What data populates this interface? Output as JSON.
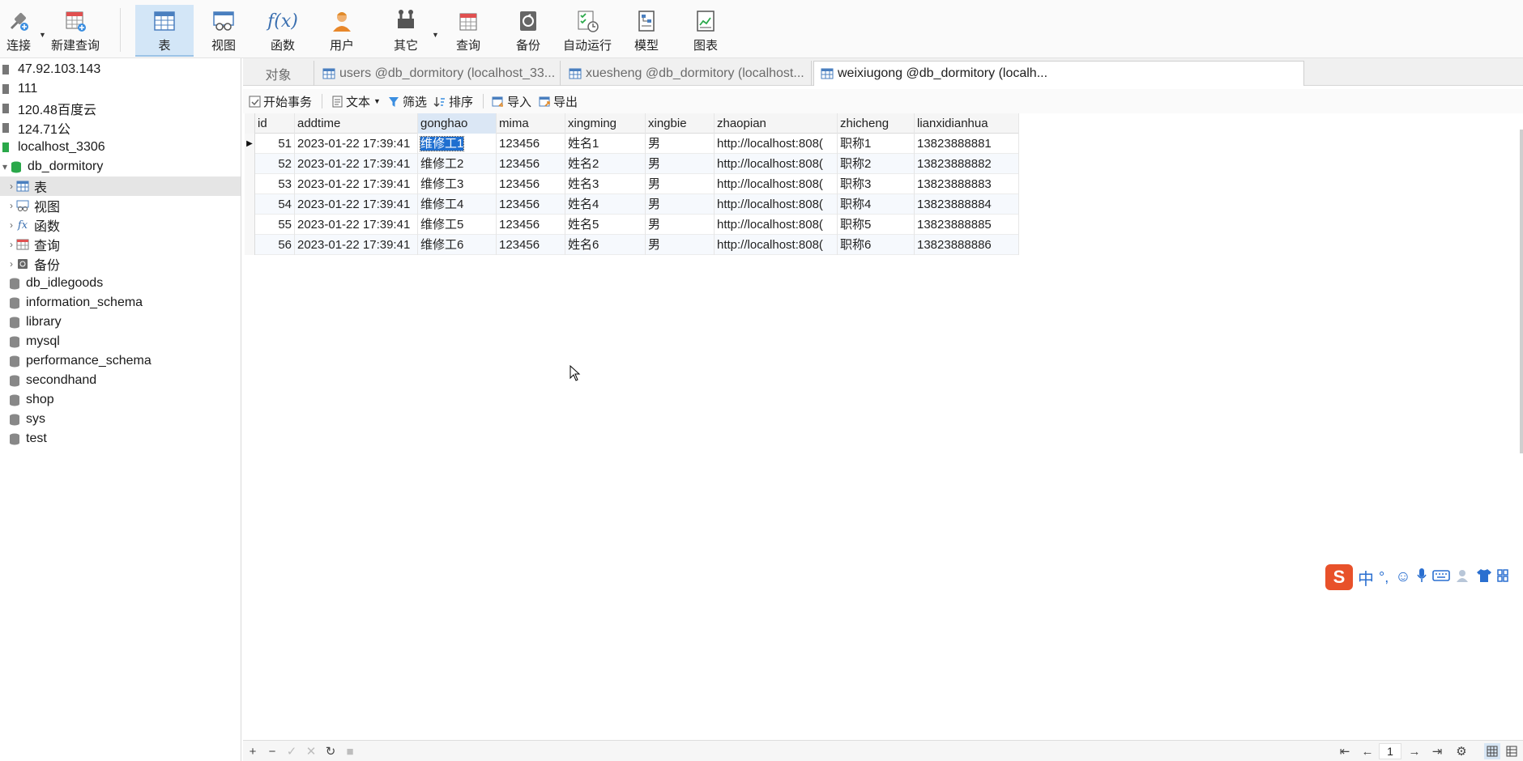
{
  "toolbar": {
    "connect": "连接",
    "new_query": "新建查询",
    "table": "表",
    "view": "视图",
    "function": "函数",
    "user": "用户",
    "other": "其它",
    "query": "查询",
    "backup": "备份",
    "auto_run": "自动运行",
    "model": "模型",
    "chart": "图表"
  },
  "sidebar": {
    "connections": [
      {
        "label": "47.92.103.143"
      },
      {
        "label": "111"
      },
      {
        "label": "120.48百度云"
      },
      {
        "label": "124.71公"
      },
      {
        "label": "localhost_3306"
      }
    ],
    "db_open": "db_dormitory",
    "db_children": [
      {
        "label": "表"
      },
      {
        "label": "视图"
      },
      {
        "label": "函数"
      },
      {
        "label": "查询"
      },
      {
        "label": "备份"
      }
    ],
    "databases": [
      {
        "label": "db_idlegoods"
      },
      {
        "label": "information_schema"
      },
      {
        "label": "library"
      },
      {
        "label": "mysql"
      },
      {
        "label": "performance_schema"
      },
      {
        "label": "secondhand"
      },
      {
        "label": "shop"
      },
      {
        "label": "sys"
      },
      {
        "label": "test"
      }
    ]
  },
  "tabs": {
    "objects": "对象",
    "tab1": "users @db_dormitory (localhost_33...",
    "tab2": "xuesheng @db_dormitory (localhost...",
    "tab3": "weixiugong @db_dormitory (localh..."
  },
  "subbar": {
    "begin_tx": "开始事务",
    "text": "文本",
    "filter": "筛选",
    "sort": "排序",
    "import": "导入",
    "export": "导出"
  },
  "grid": {
    "columns": [
      "id",
      "addtime",
      "gonghao",
      "mima",
      "xingming",
      "xingbie",
      "zhaopian",
      "zhicheng",
      "lianxidianhua"
    ],
    "rows": [
      [
        "51",
        "2023-01-22 17:39:41",
        "维修工1",
        "123456",
        "姓名1",
        "男",
        "http://localhost:808(",
        "职称1",
        "13823888881"
      ],
      [
        "52",
        "2023-01-22 17:39:41",
        "维修工2",
        "123456",
        "姓名2",
        "男",
        "http://localhost:808(",
        "职称2",
        "13823888882"
      ],
      [
        "53",
        "2023-01-22 17:39:41",
        "维修工3",
        "123456",
        "姓名3",
        "男",
        "http://localhost:808(",
        "职称3",
        "13823888883"
      ],
      [
        "54",
        "2023-01-22 17:39:41",
        "维修工4",
        "123456",
        "姓名4",
        "男",
        "http://localhost:808(",
        "职称4",
        "13823888884"
      ],
      [
        "55",
        "2023-01-22 17:39:41",
        "维修工5",
        "123456",
        "姓名5",
        "男",
        "http://localhost:808(",
        "职称5",
        "13823888885"
      ],
      [
        "56",
        "2023-01-22 17:39:41",
        "维修工6",
        "123456",
        "姓名6",
        "男",
        "http://localhost:808(",
        "职称6",
        "13823888886"
      ]
    ]
  },
  "bottombar": {
    "page": "1"
  },
  "ime": {
    "mode": "中",
    "punct": "°,"
  },
  "colors": {
    "accent": "#1f6fd0",
    "active_tool": "#d3e6f7",
    "db_green": "#2aa84a"
  }
}
